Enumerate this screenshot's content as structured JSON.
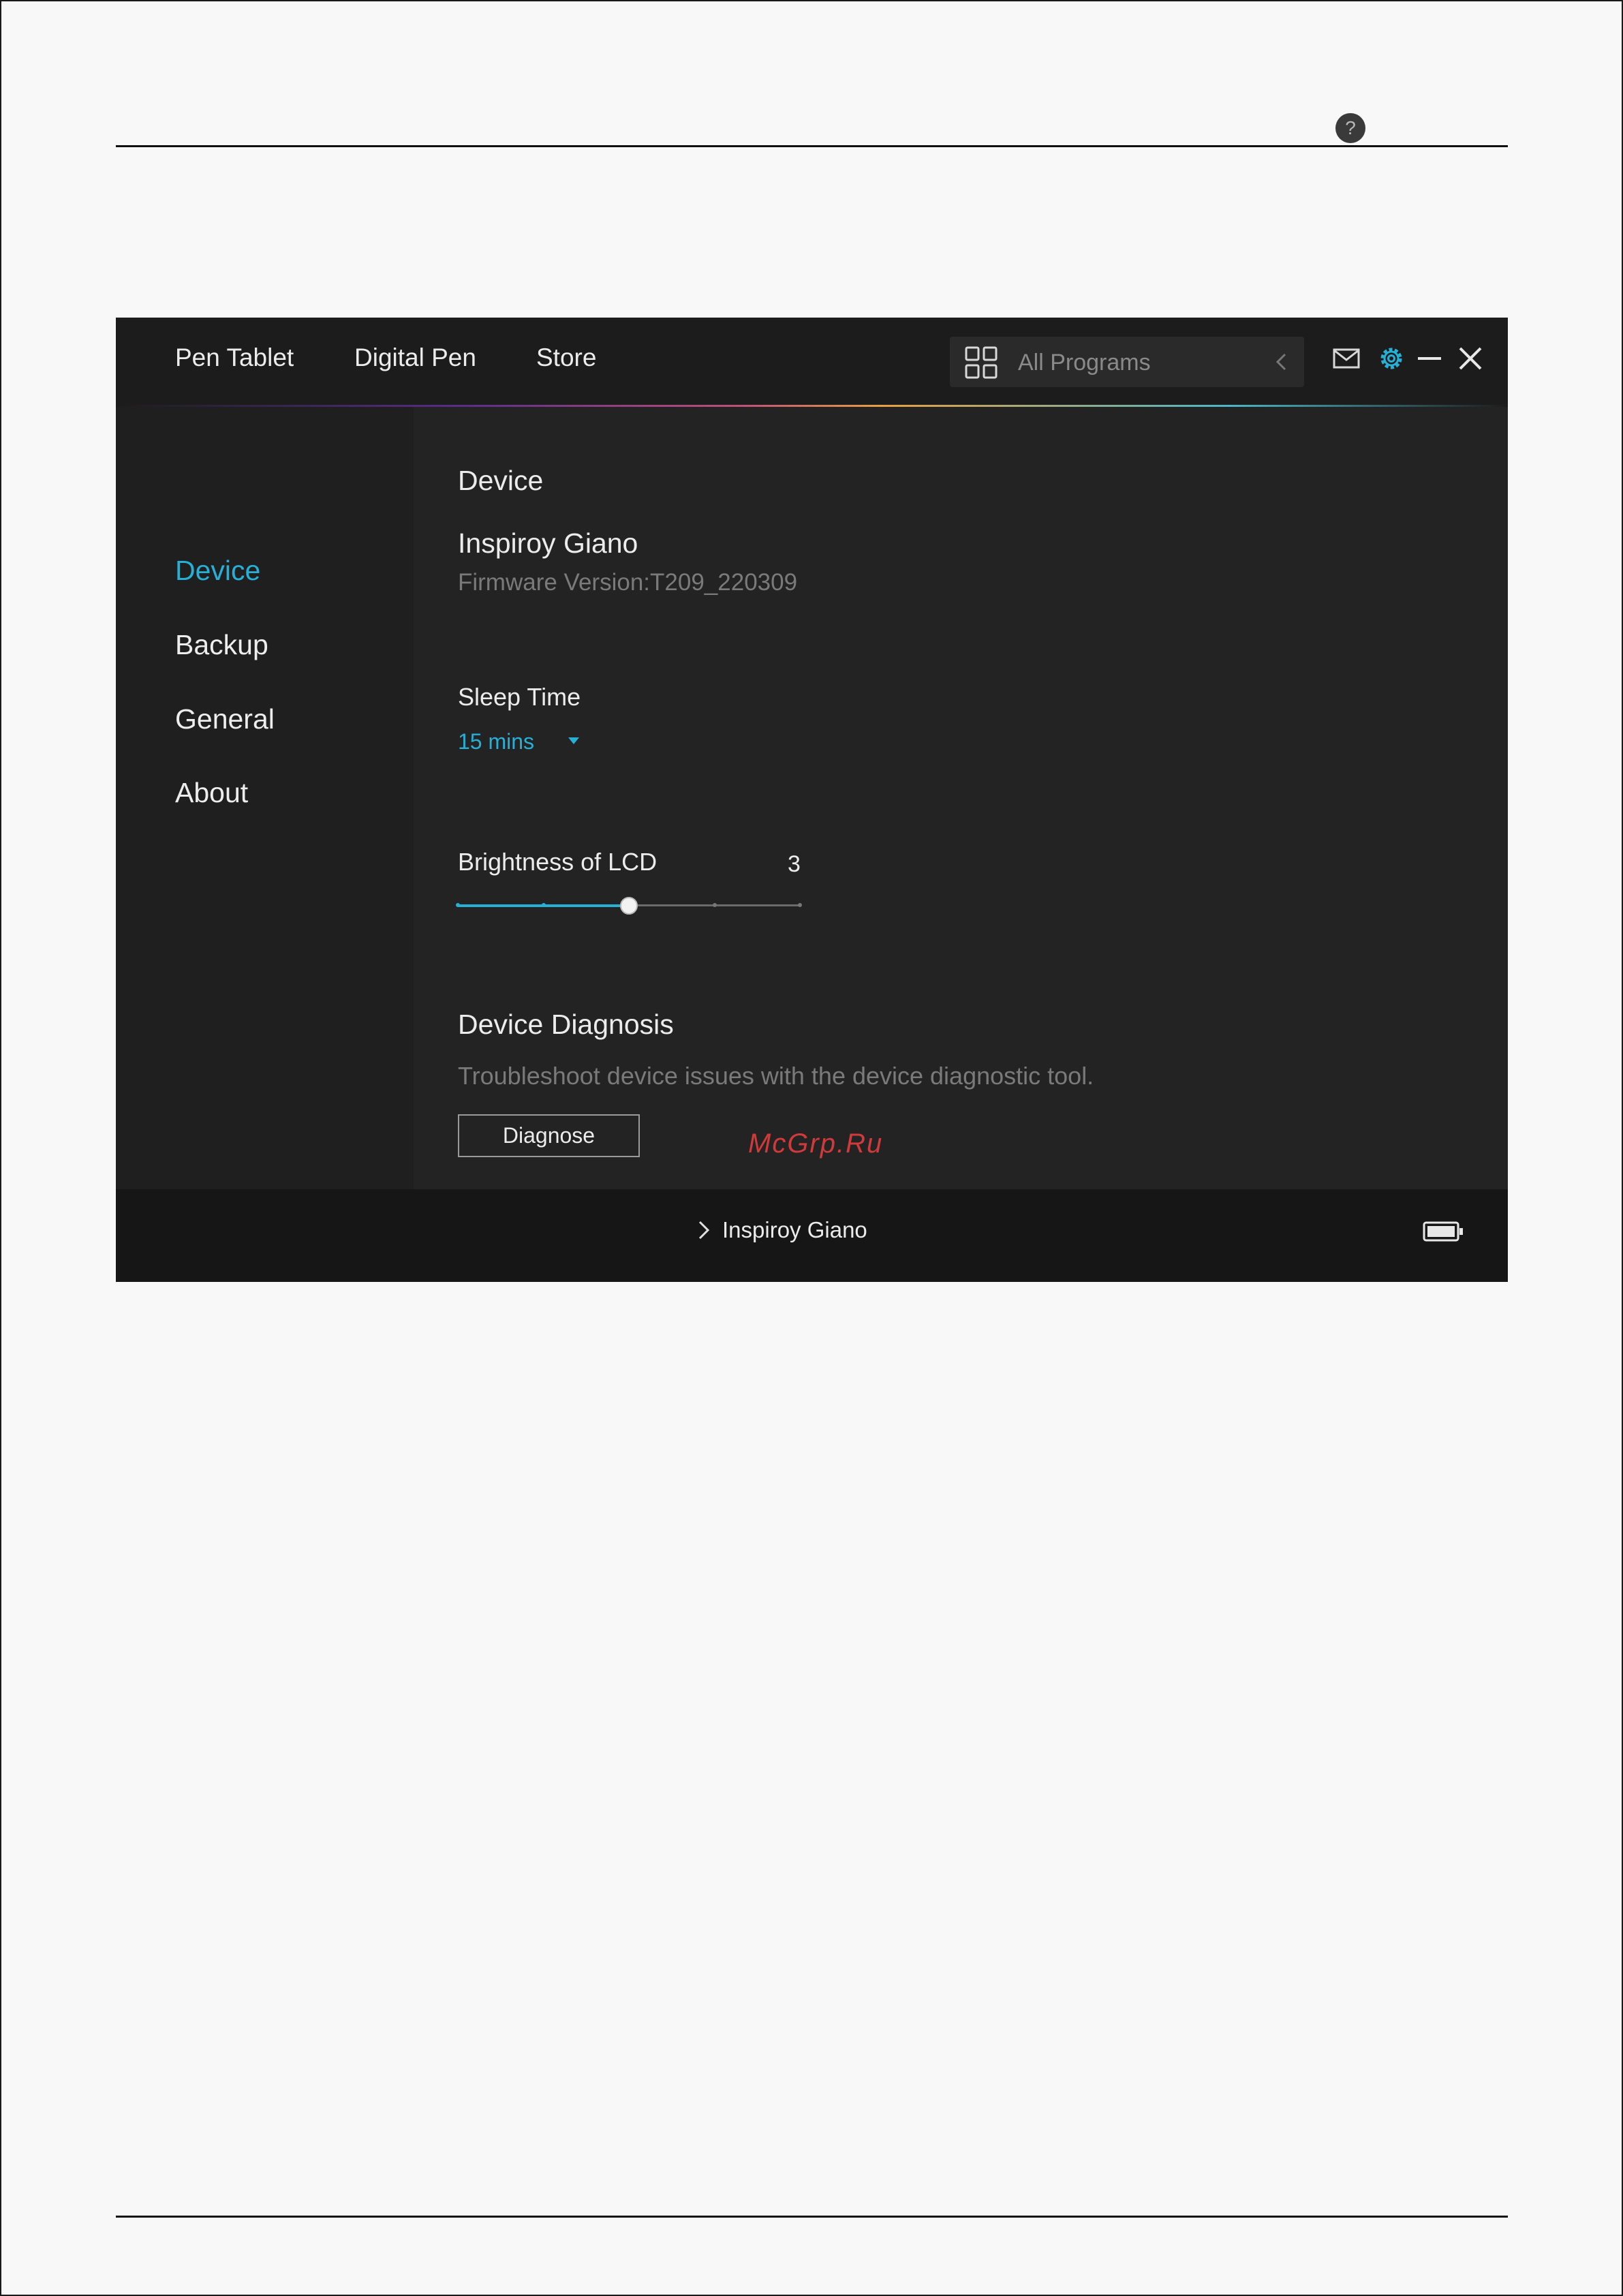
{
  "nav": {
    "pen_tablet": "Pen Tablet",
    "digital_pen": "Digital Pen",
    "store": "Store"
  },
  "program": {
    "label": "All Programs"
  },
  "sidebar": {
    "items": [
      {
        "label": "Device",
        "active": true
      },
      {
        "label": "Backup",
        "active": false
      },
      {
        "label": "General",
        "active": false
      },
      {
        "label": "About",
        "active": false
      }
    ]
  },
  "main": {
    "section_title": "Device",
    "help_label": "?",
    "device_name": "Inspiroy Giano",
    "firmware": "Firmware Version:T209_220309",
    "sleep": {
      "label": "Sleep Time",
      "value": "15 mins"
    },
    "brightness": {
      "label": "Brightness of LCD",
      "value": 3,
      "min": 1,
      "max": 5
    },
    "diagnosis": {
      "title": "Device Diagnosis",
      "description": "Troubleshoot device issues with the device diagnostic tool.",
      "button_label": "Diagnose"
    }
  },
  "status": {
    "device_label": "Inspiroy Giano"
  },
  "watermark": "McGrp.Ru",
  "colors": {
    "accent": "#27b0d6",
    "background": "#232324",
    "watermark": "#d03a3a"
  },
  "icons": {
    "program_grid": "grid-icon",
    "back": "chevron-left-icon",
    "mail": "mail-icon",
    "settings": "gear-icon",
    "minimize": "minimize-icon",
    "close": "close-icon",
    "help": "help-icon",
    "status_expand": "chevron-right-icon",
    "battery": "battery-icon"
  }
}
